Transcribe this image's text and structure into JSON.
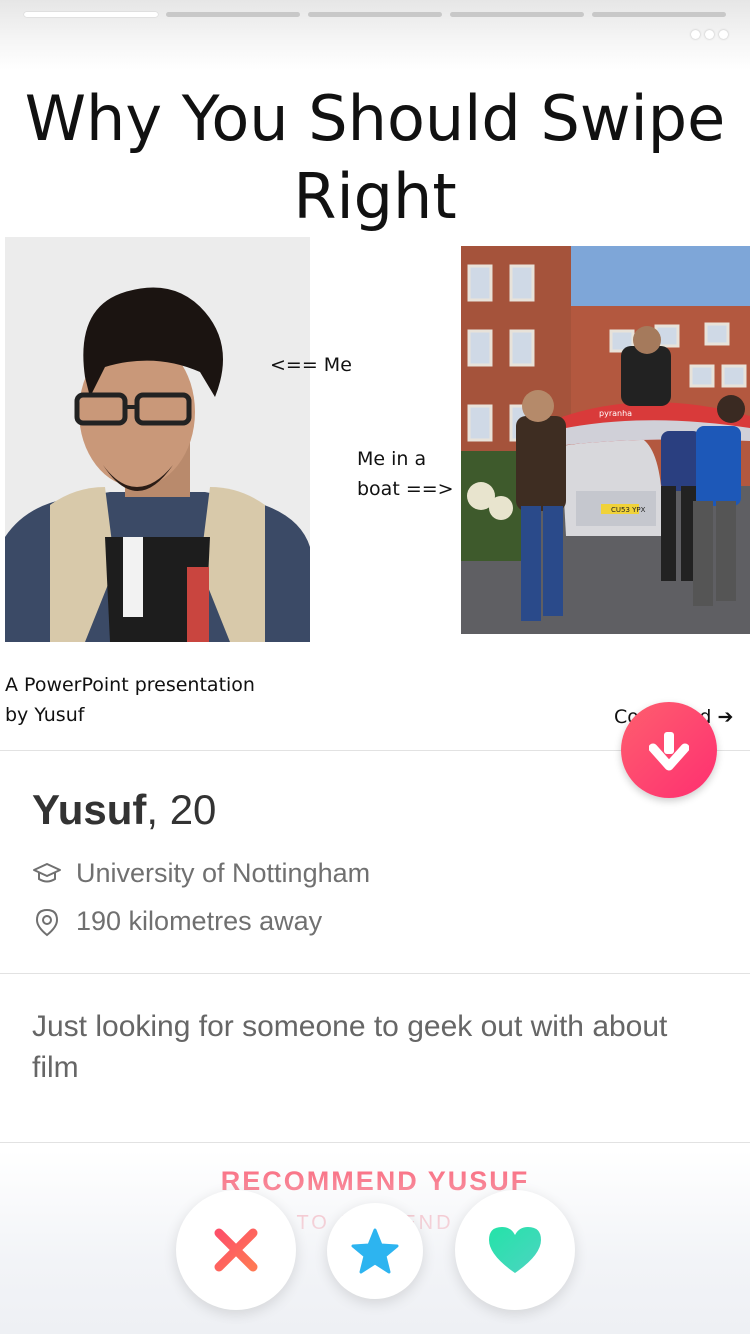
{
  "progress": {
    "total": 5,
    "active_index": 0
  },
  "slide": {
    "title_line1": "Why You Should Swipe",
    "title_line2": "Right",
    "caption_me": "<== Me",
    "caption_boat_line1": "Me in a",
    "caption_boat_line2": "boat ==>",
    "caption_ppt_line1": "A PowerPoint presentation",
    "caption_ppt_line2": "by Yusuf",
    "caption_continued": "Continued",
    "kayak_brand": "pyranha",
    "plate": "CU53 YPX"
  },
  "profile": {
    "name": "Yusuf",
    "age": "20",
    "school": "University of Nottingham",
    "distance": "190 kilometres away",
    "bio": "Just looking for someone to geek out with about film"
  },
  "recommend": {
    "label": "RECOMMEND YUSUF",
    "sub_label": "TO A FRIEND"
  },
  "colors": {
    "brand": "#fd5068",
    "nope": "#fd5068",
    "super_like": "#2db4f0",
    "like": "#34dcb5"
  },
  "icons": {
    "more": "ellipsis-icon",
    "collapse": "arrow-down-icon",
    "school": "graduation-cap-icon",
    "location": "location-pin-icon",
    "nope": "x-icon",
    "super_like": "star-icon",
    "like": "heart-icon"
  }
}
